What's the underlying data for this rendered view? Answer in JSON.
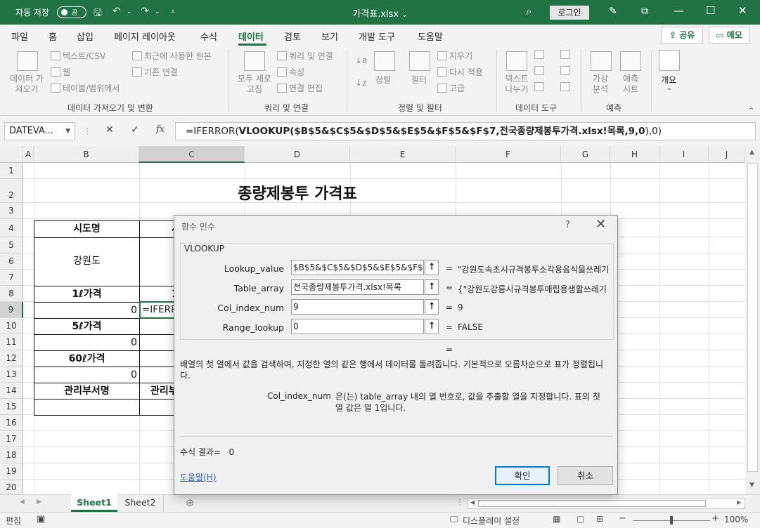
{
  "titlebar": {
    "autosave_label": "자동 저장",
    "autosave_state": "끔",
    "file_name": "가격표.xlsx",
    "dropdown": "⌄",
    "login": "로그인"
  },
  "menu": {
    "items": [
      "파일",
      "홈",
      "삽입",
      "페이지 레이아웃",
      "수식",
      "데이터",
      "검토",
      "보기",
      "개발 도구",
      "도움말"
    ],
    "active": "데이터",
    "share": "공유",
    "memo": "메모"
  },
  "ribbon": {
    "get_data": "데이터 가져오기",
    "text_csv": "텍스트/CSV",
    "web": "웹",
    "table_range": "테이블/범위에서",
    "recent_sources": "최근에 사용한 원본",
    "existing_connections": "기존 연결",
    "group_get_transform": "데이터 가져오기 및 변환",
    "refresh_all": "모두 새로 고침",
    "queries_connections": "쿼리 및 연결",
    "properties": "속성",
    "edit_links": "연결 편집",
    "group_queries": "쿼리 및 연결",
    "sort": "정렬",
    "filter": "필터",
    "clear": "지우기",
    "reapply": "다시 적용",
    "advanced": "고급",
    "group_sort_filter": "정렬 및 필터",
    "text_to_columns": "텍스트 나누기",
    "group_data_tools": "데이터 도구",
    "whatif": "가상 분석",
    "forecast_sheet": "예측 시트",
    "group_forecast": "예측",
    "outline": "개요"
  },
  "formula_bar": {
    "name_box": "DATEVA...",
    "fx": "fx",
    "formula_prefix": "=IFERROR(",
    "formula_fn": "VLOOKUP(",
    "formula_args": "$B$5&$C$5&$D$5&$E$5&$F$5&$F$7,전국종량제봉투가격.xlsx!목록,9,0",
    "formula_close": ")",
    "formula_suffix": ",0)"
  },
  "grid": {
    "columns": [
      "A",
      "B",
      "C",
      "D",
      "E",
      "F",
      "G",
      "H",
      "I",
      "J"
    ],
    "selected_column": "C",
    "rows": [
      "1",
      "2",
      "3",
      "4",
      "5",
      "6",
      "7",
      "8",
      "9",
      "10",
      "11",
      "12",
      "13",
      "14",
      "15",
      "16",
      "17",
      "18",
      "19",
      "20"
    ],
    "selected_row": "9",
    "title": "종량제봉투 가격표",
    "cells": {
      "b4": "시도명",
      "c4_partial": "시",
      "b5": "강원도",
      "b8": "1ℓ가격",
      "c8_partial": "1",
      "b9": "0",
      "c9": "=IFERROR",
      "b10": "5ℓ가격",
      "b11": "0",
      "b12": "60ℓ가격",
      "b13": "0",
      "b14": "관리부서명",
      "c14_partial": "관리부"
    }
  },
  "dialog": {
    "title": "함수 인수",
    "help_icon": "?",
    "function_name": "VLOOKUP",
    "args": [
      {
        "label": "Lookup_value",
        "value": "$B$5&$C$5&$D$5&$E$5&$F$5&$F$7",
        "result": "\"강원도속초시규격봉투소각용음식물쓰레기"
      },
      {
        "label": "Table_array",
        "value": "전국종량제봉투가격.xlsx!목록",
        "result": "{\"강원도강릉시규격봉투매립용생활쓰레기"
      },
      {
        "label": "Col_index_num",
        "value": "9",
        "result": "9"
      },
      {
        "label": "Range_lookup",
        "value": "0",
        "result": "FALSE"
      }
    ],
    "overall_eq": "=",
    "description": "배열의 첫 열에서 값을 검색하여, 지정한 열의 같은 행에서 데이터를 돌려줍니다. 기본적으로 오름차순으로 표가 정렬됩니다.",
    "arg_desc_name": "Col_index_num",
    "arg_desc_text": "은(는) table_array 내의 열 번호로, 값을 추출할 열을 지정합니다. 표의 첫 열 값은 열 1입니다.",
    "result_label": "수식 결과=",
    "result_value": "0",
    "help_link": "도움말(H)",
    "ok": "확인",
    "cancel": "취소"
  },
  "sheets": {
    "tabs": [
      "Sheet1",
      "Sheet2"
    ],
    "active": "Sheet1"
  },
  "status": {
    "mode": "편집",
    "display_settings": "디스플레이 설정",
    "zoom": "100%"
  }
}
